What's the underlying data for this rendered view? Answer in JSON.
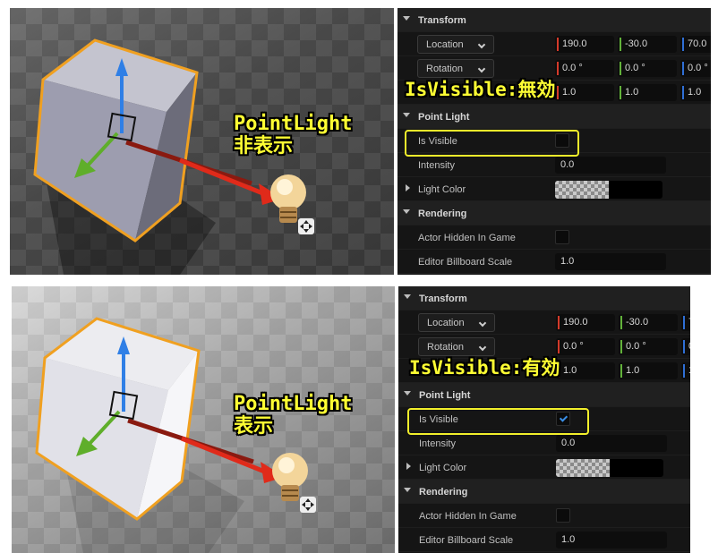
{
  "top": {
    "annotation_light": [
      "PointLight",
      "非表示"
    ],
    "annotation_visible": "IsVisible:無効",
    "transform_title": "Transform",
    "location": {
      "label": "Location",
      "x": "190.0",
      "y": "-30.0",
      "z": "70.0"
    },
    "rotation": {
      "label": "Rotation",
      "x": "0.0 °",
      "y": "0.0 °",
      "z": "0.0 °"
    },
    "scale": {
      "x": "1.0",
      "y": "1.0",
      "z": "1.0"
    },
    "point_light_title": "Point Light",
    "is_visible": {
      "label": "Is Visible",
      "checked": false
    },
    "intensity": {
      "label": "Intensity",
      "value": "0.0"
    },
    "light_color": {
      "label": "Light Color"
    },
    "rendering_title": "Rendering",
    "actor_hidden": {
      "label": "Actor Hidden In Game",
      "checked": false
    },
    "billboard": {
      "label": "Editor Billboard Scale",
      "value": "1.0"
    }
  },
  "bottom": {
    "annotation_light": [
      "PointLight",
      "表示"
    ],
    "annotation_visible": "IsVisible:有効",
    "transform_title": "Transform",
    "location": {
      "label": "Location",
      "x": "190.0",
      "y": "-30.0",
      "z": "7"
    },
    "rotation": {
      "label": "Rotation",
      "x": "0.0 °",
      "y": "0.0 °",
      "z": "0"
    },
    "scale": {
      "x": "1.0",
      "y": "1.0",
      "z": "1"
    },
    "point_light_title": "Point Light",
    "is_visible": {
      "label": "Is Visible",
      "checked": true
    },
    "intensity": {
      "label": "Intensity",
      "value": "0.0"
    },
    "light_color": {
      "label": "Light Color"
    },
    "rendering_title": "Rendering",
    "actor_hidden": {
      "label": "Actor Hidden In Game",
      "checked": false
    },
    "billboard": {
      "label": "Editor Billboard Scale",
      "value": "1.0"
    }
  },
  "colors": {
    "highlight": "#f2ef2b",
    "cube_outline": "#f0a020",
    "axis_red": "#e02a1a",
    "axis_green": "#5fae2a",
    "axis_blue": "#2f7fe6",
    "checkbox_check": "#3a8ee6"
  },
  "icons": [
    "cube-mesh",
    "transform-gizmo",
    "lightbulb-icon",
    "move-arrows-icon",
    "checkmark-icon",
    "chevron-down-icon"
  ]
}
